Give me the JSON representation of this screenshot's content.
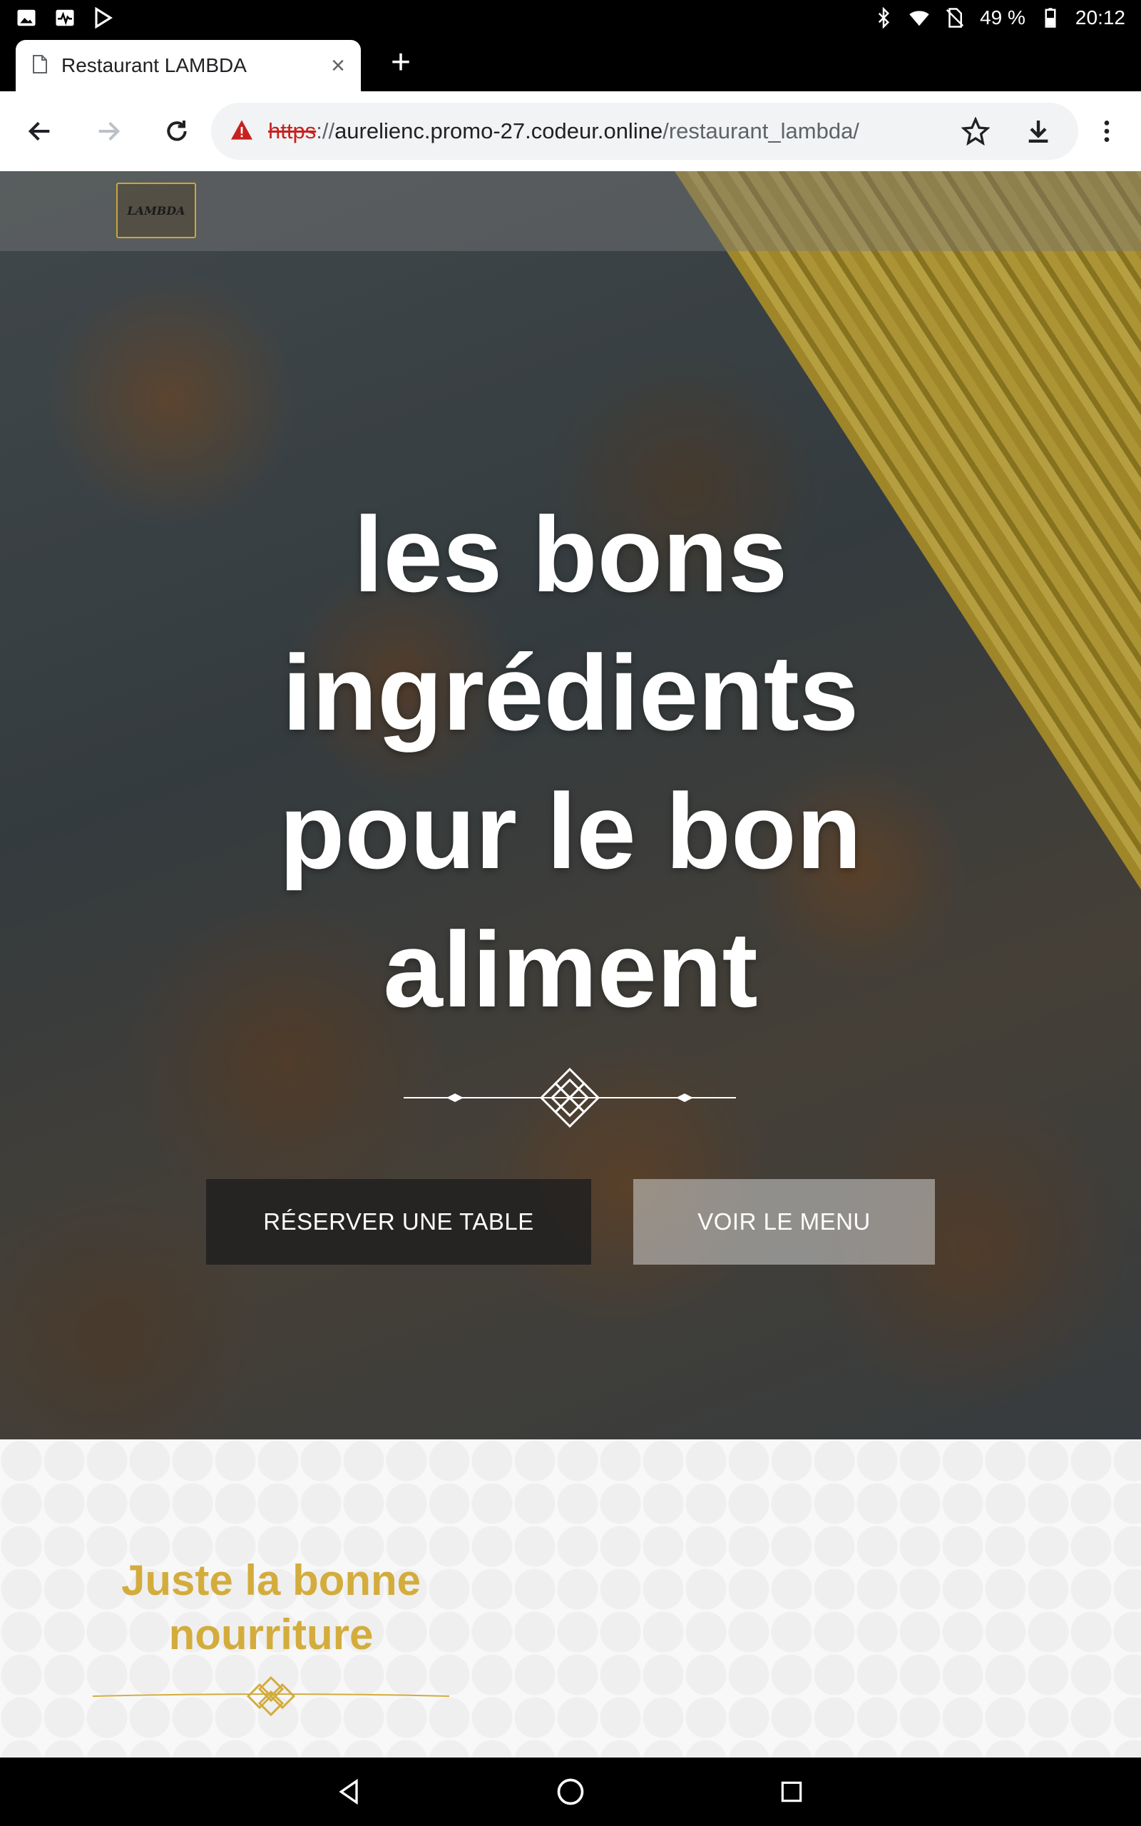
{
  "status_bar": {
    "battery": "49 %",
    "time": "20:12",
    "icons": [
      "gallery-icon",
      "activity-icon",
      "play-store-icon",
      "bluetooth-icon",
      "wifi-icon",
      "no-sim-icon",
      "battery-icon"
    ]
  },
  "browser": {
    "tab_title": "Restaurant LAMBDA",
    "url": {
      "scheme": "https",
      "separator": "://",
      "host": "aurelienc.promo-27.codeur.online",
      "path": "/restaurant_lambda/"
    }
  },
  "site": {
    "logo_text": "LAMBDA",
    "hero_title": "les bons ingrédients pour le bon aliment",
    "buttons": {
      "reserve": "RÉSERVER UNE TABLE",
      "menu": "VOIR LE MENU"
    },
    "section_title": "Juste la bonne nourriture"
  },
  "colors": {
    "accent_gold": "#d3ac3c",
    "url_warning_red": "#c5221f"
  }
}
